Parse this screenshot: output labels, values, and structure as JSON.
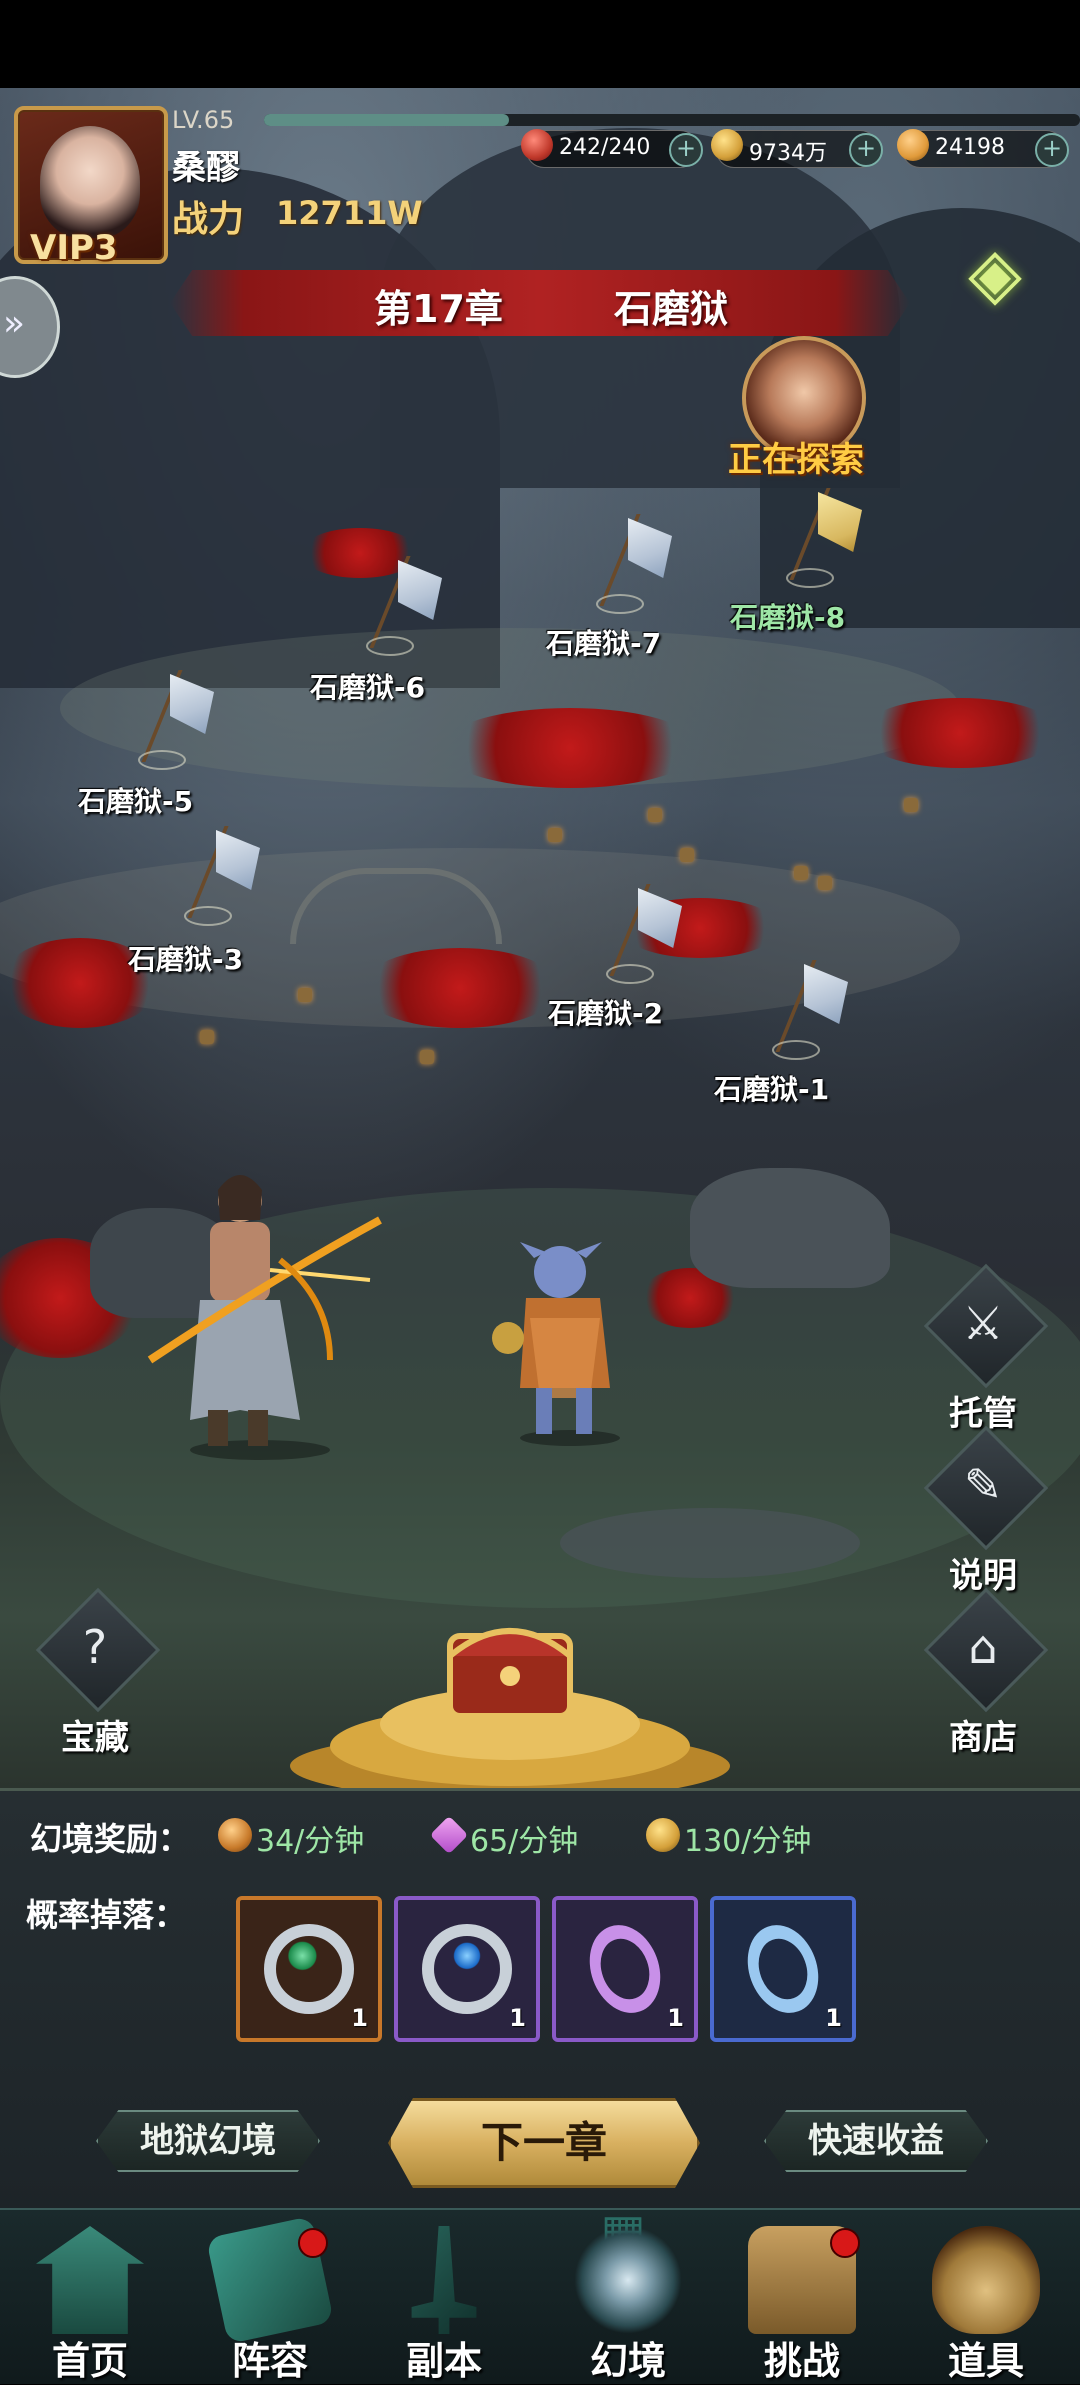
{
  "player": {
    "level": "LV.65",
    "name": "桑醪",
    "vip": "VIP3",
    "power_label": "战力",
    "power_value": "12711W",
    "exp_fraction": 0.3
  },
  "resources": [
    {
      "icon": "stamina-orb-icon",
      "value": "242/240",
      "color": "#c0392b"
    },
    {
      "icon": "copper-coin-icon",
      "value": "9734万",
      "color": "#d4a03a"
    },
    {
      "icon": "gold-coin-icon",
      "value": "24198",
      "color": "#e09a3a"
    }
  ],
  "chapter": {
    "number": "第17章",
    "name": "石磨狱"
  },
  "exploring": {
    "label": "正在探索"
  },
  "stages": [
    {
      "label": "石磨狱-1",
      "status": "cleared"
    },
    {
      "label": "石磨狱-2",
      "status": "cleared"
    },
    {
      "label": "石磨狱-3",
      "status": "cleared"
    },
    {
      "label": "石磨狱-5",
      "status": "cleared"
    },
    {
      "label": "石磨狱-6",
      "status": "cleared"
    },
    {
      "label": "石磨狱-7",
      "status": "cleared"
    },
    {
      "label": "石磨狱-8",
      "status": "current"
    }
  ],
  "side_buttons": {
    "auto": "托管",
    "info": "说明",
    "shop": "商店",
    "treasure": "宝藏"
  },
  "rewards": {
    "label": "幻境奖励：",
    "items": [
      {
        "icon": "copper-coin-icon",
        "rate": "34/分钟"
      },
      {
        "icon": "purple-gem-icon",
        "rate": "65/分钟"
      },
      {
        "icon": "gold-coin-icon",
        "rate": "130/分钟"
      }
    ]
  },
  "drops": {
    "label": "概率掉落：",
    "items": [
      {
        "icon": "jade-ring-icon",
        "count": "1",
        "frame": "#c8782a"
      },
      {
        "icon": "sapphire-ring-icon",
        "count": "1",
        "frame": "#8a5ac8"
      },
      {
        "icon": "purple-ring-icon",
        "count": "1",
        "frame": "#8a5ac8"
      },
      {
        "icon": "blue-ring-icon",
        "count": "1",
        "frame": "#4a6ad0"
      }
    ]
  },
  "buttons": {
    "hell_realm": "地狱幻境",
    "next_chapter": "下一章",
    "fast_reward": "快速收益"
  },
  "nav": [
    {
      "label": "首页",
      "icon": "home-pagoda-icon",
      "badge": false
    },
    {
      "label": "阵容",
      "icon": "lineup-book-icon",
      "badge": true
    },
    {
      "label": "副本",
      "icon": "dungeon-sword-icon",
      "badge": false
    },
    {
      "label": "幻境",
      "icon": "illusion-swords-icon",
      "badge": false,
      "active": true
    },
    {
      "label": "挑战",
      "icon": "challenge-scroll-icon",
      "badge": true
    },
    {
      "label": "道具",
      "icon": "item-bag-icon",
      "badge": false
    }
  ],
  "colors": {
    "accent_gold": "#f4d27a",
    "reward_green": "#9ee6a6",
    "banner_red": "#b02222"
  }
}
